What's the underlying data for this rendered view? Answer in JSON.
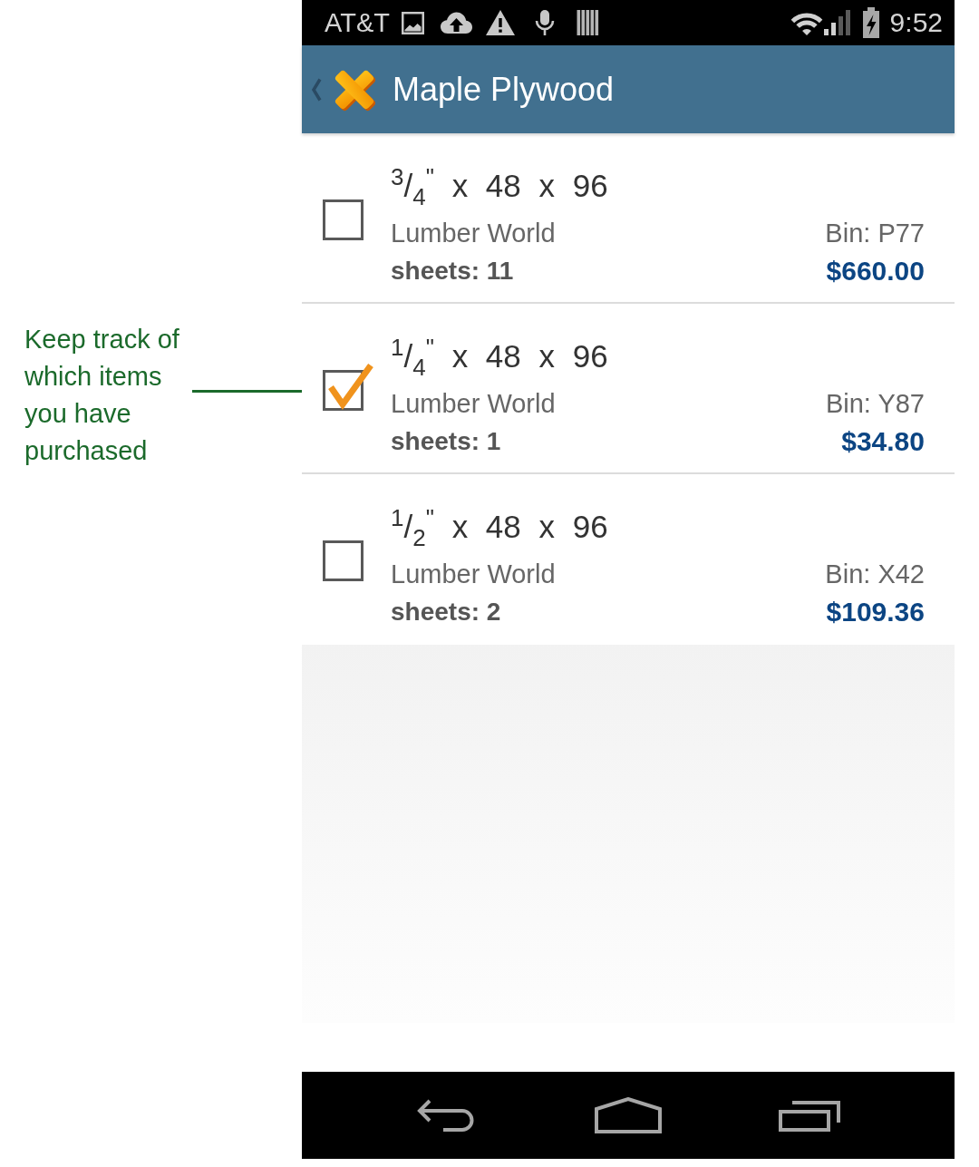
{
  "status_bar": {
    "carrier": "AT&T",
    "time": "9:52"
  },
  "action_bar": {
    "title": "Maple Plywood"
  },
  "items": [
    {
      "checked": false,
      "dimensions": "$^{3}$/$_{4}$$^{\"}$ x 48 x 96",
      "store": "Lumber World",
      "quantity": "sheets: 11",
      "bin": "Bin: P77",
      "price": "$660.00"
    },
    {
      "checked": true,
      "dimensions": "$^{1}$/$_{4}$$^{\"}$ x 48 x 96",
      "store": "Lumber World",
      "quantity": "sheets: 1",
      "bin": "Bin: Y87",
      "price": "$34.80"
    },
    {
      "checked": false,
      "dimensions": "$^{1}$/$_{2}$$^{\"}$ x 48 x 96",
      "store": "Lumber World",
      "quantity": "sheets: 2",
      "bin": "Bin: X42",
      "price": "$109.36"
    }
  ],
  "annotation": {
    "text": "Keep track of which items you have purchased"
  }
}
